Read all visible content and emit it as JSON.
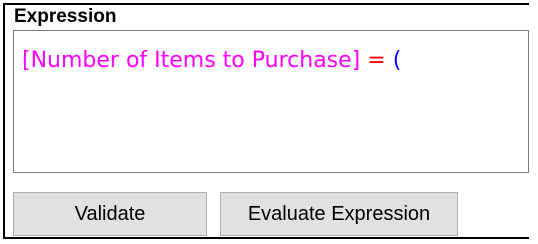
{
  "expression_panel": {
    "label": "Expression",
    "tokens": {
      "field": "[Number of Items to Purchase]",
      "space1": " ",
      "operator": "=",
      "space2": " ",
      "paren": "("
    }
  },
  "buttons": {
    "validate_label": "Validate",
    "evaluate_label": "Evaluate Expression"
  },
  "colors": {
    "field_token": "#ff00ff",
    "operator_token": "#ff0000",
    "paren_token": "#0000ff",
    "button_face": "#e1e1e1"
  }
}
